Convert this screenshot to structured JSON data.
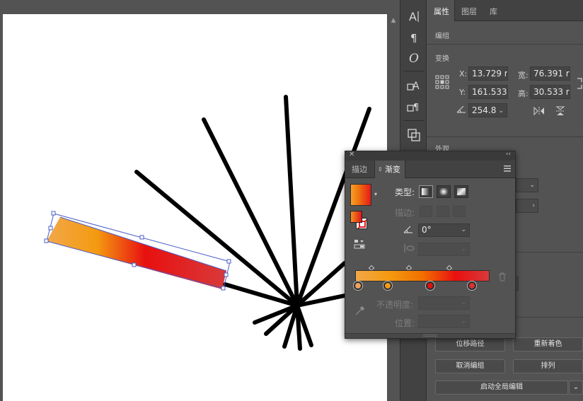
{
  "canvas": {
    "scroll_arrow": "▲"
  },
  "tools": [
    {
      "name": "area-type-icon"
    },
    {
      "name": "paragraph-icon"
    },
    {
      "name": "opentype-icon"
    },
    {
      "name": "character-styles-icon"
    },
    {
      "name": "paragraph-styles-icon"
    },
    {
      "name": "pathfinder-icon"
    }
  ],
  "properties": {
    "tabs": [
      "属性",
      "图层",
      "库"
    ],
    "active_tab": "属性",
    "object_type": "编组",
    "transform": {
      "title": "变换",
      "x_label": "X:",
      "x_value": "13.729 r",
      "y_label": "Y:",
      "y_value": "161.533",
      "w_label": "宽:",
      "w_value": "76.391 r",
      "h_label": "高:",
      "h_value": "30.533 r",
      "angle_value": "254.8"
    },
    "appearance": {
      "title": "外观"
    },
    "quick_actions": {
      "offset_path": "位移路径",
      "recolor": "重新着色",
      "ungroup": "取消编组",
      "arrange": "排列",
      "global_edit": "启动全局编辑"
    }
  },
  "gradient_panel": {
    "tabs": [
      "描边",
      "渐变"
    ],
    "active_tab": "渐变",
    "type_label": "类型:",
    "stroke_label": "描边:",
    "angle_value": "0°",
    "opacity_label": "不透明度:",
    "location_label": "位置:",
    "stops": [
      {
        "color": "#f0a060",
        "location": 0.02
      },
      {
        "color": "#f29a18",
        "location": 0.24
      },
      {
        "color": "#e01010",
        "location": 0.56
      },
      {
        "color": "#d83232",
        "location": 0.87
      }
    ],
    "midpoints": [
      0.12,
      0.4,
      0.7
    ],
    "gradient_colors": [
      "#f2a84a",
      "#f49a10",
      "#f07000",
      "#e81010",
      "#d83a3a"
    ]
  },
  "colors": {
    "panel_bg": "#535353",
    "panel_dark": "#424242",
    "selection_blue": "#4a5cc8"
  }
}
